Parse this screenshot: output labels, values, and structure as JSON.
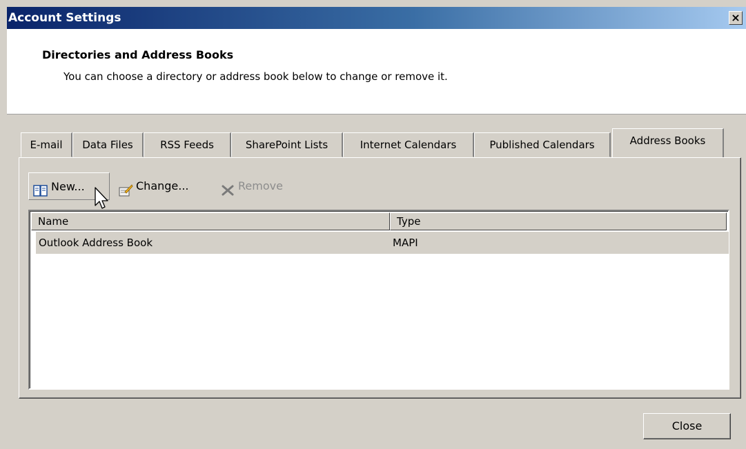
{
  "window": {
    "title": "Account Settings",
    "close_glyph": "×"
  },
  "header": {
    "title": "Directories and Address Books",
    "description": "You can choose a directory or address book below to change or remove it."
  },
  "tabs": [
    {
      "label": "E-mail",
      "active": false
    },
    {
      "label": "Data Files",
      "active": false
    },
    {
      "label": "RSS Feeds",
      "active": false
    },
    {
      "label": "SharePoint Lists",
      "active": false
    },
    {
      "label": "Internet Calendars",
      "active": false
    },
    {
      "label": "Published Calendars",
      "active": false
    },
    {
      "label": "Address Books",
      "active": true
    }
  ],
  "toolbar": {
    "new_label": "New...",
    "new_icon": "address-book-icon",
    "change_label": "Change...",
    "change_icon": "change-icon",
    "remove_label": "Remove",
    "remove_icon": "remove-x-icon"
  },
  "list": {
    "columns": [
      "Name",
      "Type"
    ],
    "rows": [
      {
        "name": "Outlook Address Book",
        "type": "MAPI"
      }
    ]
  },
  "footer": {
    "close_label": "Close"
  },
  "colors": {
    "title_start": "#0a246a",
    "title_end": "#a6caf0",
    "face": "#d4d0c8"
  }
}
